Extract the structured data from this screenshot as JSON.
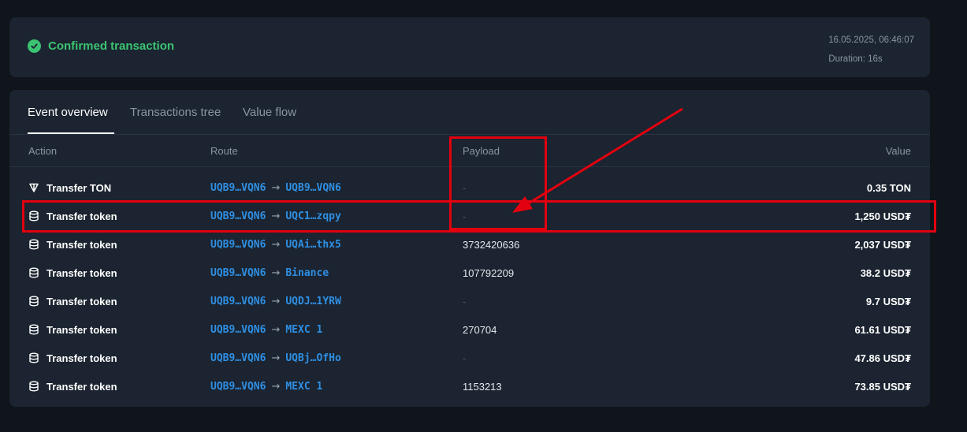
{
  "summary": {
    "status": "Confirmed transaction",
    "timestamp": "16.05.2025, 06:46:07",
    "duration": "Duration: 16s",
    "status_color": "#3cc472"
  },
  "tabs": [
    {
      "label": "Event overview",
      "active": true
    },
    {
      "label": "Transactions tree",
      "active": false
    },
    {
      "label": "Value flow",
      "active": false
    }
  ],
  "columns": {
    "action": "Action",
    "route": "Route",
    "payload": "Payload",
    "value": "Value"
  },
  "rows": [
    {
      "icon": "ton-icon",
      "action": "Transfer TON",
      "from": "UQB9…VQN6",
      "to": "UQB9…VQN6",
      "payload": "-",
      "value": "0.35 TON"
    },
    {
      "icon": "database-icon",
      "action": "Transfer token",
      "from": "UQB9…VQN6",
      "to": "UQC1…zqpy",
      "payload": "-",
      "value": "1,250 USD₮"
    },
    {
      "icon": "database-icon",
      "action": "Transfer token",
      "from": "UQB9…VQN6",
      "to": "UQAi…thx5",
      "payload": "3732420636",
      "value": "2,037 USD₮"
    },
    {
      "icon": "database-icon",
      "action": "Transfer token",
      "from": "UQB9…VQN6",
      "to": "Binance",
      "payload": "107792209",
      "value": "38.2 USD₮"
    },
    {
      "icon": "database-icon",
      "action": "Transfer token",
      "from": "UQB9…VQN6",
      "to": "UQDJ…1YRW",
      "payload": "-",
      "value": "9.7 USD₮"
    },
    {
      "icon": "database-icon",
      "action": "Transfer token",
      "from": "UQB9…VQN6",
      "to": "MEXC 1",
      "payload": "270704",
      "value": "61.61 USD₮"
    },
    {
      "icon": "database-icon",
      "action": "Transfer token",
      "from": "UQB9…VQN6",
      "to": "UQBj…OfHo",
      "payload": "-",
      "value": "47.86 USD₮"
    },
    {
      "icon": "database-icon",
      "action": "Transfer token",
      "from": "UQB9…VQN6",
      "to": "MEXC 1",
      "payload": "1153213",
      "value": "73.85 USD₮"
    }
  ],
  "colors": {
    "accent": "#2f8fe3",
    "annotation": "#e3000f",
    "card": "#1b2430",
    "background": "#10151c"
  }
}
